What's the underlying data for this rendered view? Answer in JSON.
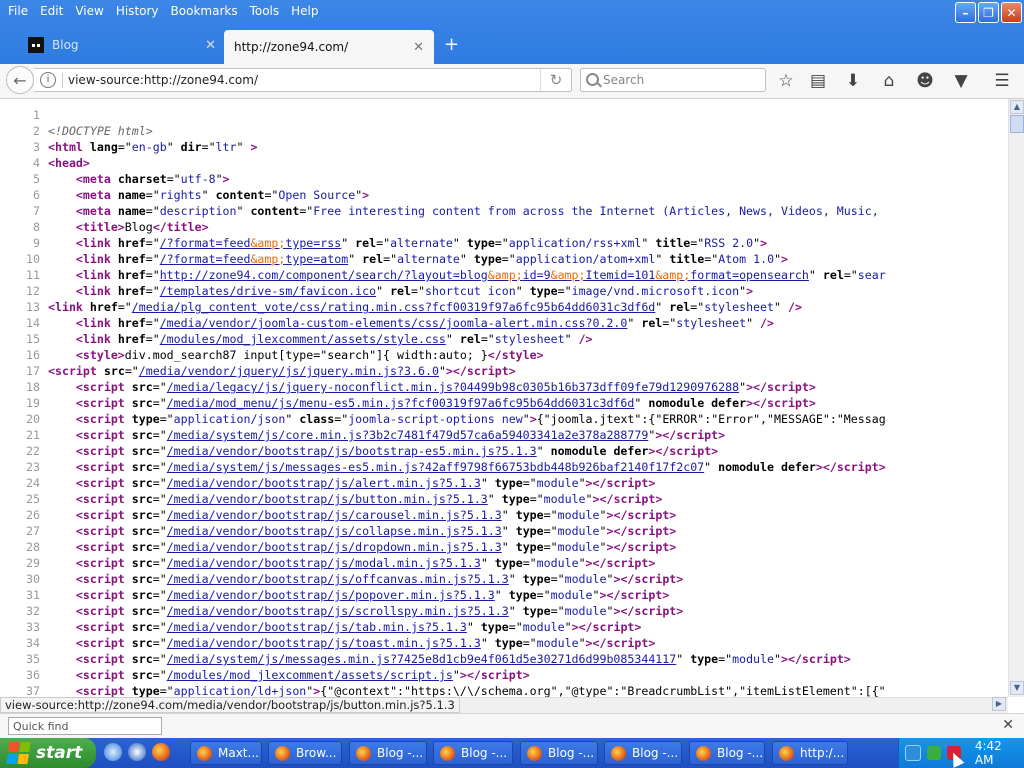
{
  "menu": [
    "File",
    "Edit",
    "View",
    "History",
    "Bookmarks",
    "Tools",
    "Help"
  ],
  "tabs": [
    {
      "title": "Blog",
      "active": false
    },
    {
      "title": "http://zone94.com/",
      "active": true
    }
  ],
  "url": "view-source:http://zone94.com/",
  "search_placeholder": "Search",
  "status_text": "view-source:http://zone94.com/media/vendor/bootstrap/js/button.min.js?5.1.3",
  "find_placeholder": "Quick find",
  "source_lines": [
    {
      "n": "1",
      "h": ""
    },
    {
      "n": "2",
      "h": "<span class=\"cmt\">&lt;!DOCTYPE html&gt;</span>"
    },
    {
      "n": "3",
      "h": "<span class=\"kw\">&lt;html</span> <span class=\"at\">lang</span>=\"<span class=\"val\">en-gb</span>\" <span class=\"at\">dir</span>=\"<span class=\"val\">ltr</span>\" <span class=\"kw\">&gt;</span>"
    },
    {
      "n": "4",
      "h": "<span class=\"kw\">&lt;head&gt;</span>"
    },
    {
      "n": "5",
      "h": "    <span class=\"kw\">&lt;meta</span> <span class=\"at\">charset</span>=\"<span class=\"val\">utf-8</span>\"<span class=\"kw\">&gt;</span>"
    },
    {
      "n": "6",
      "h": "    <span class=\"kw\">&lt;meta</span> <span class=\"at\">name</span>=\"<span class=\"val\">rights</span>\" <span class=\"at\">content</span>=\"<span class=\"val\">Open Source</span>\"<span class=\"kw\">&gt;</span>"
    },
    {
      "n": "7",
      "h": "    <span class=\"kw\">&lt;meta</span> <span class=\"at\">name</span>=\"<span class=\"val\">description</span>\" <span class=\"at\">content</span>=\"<span class=\"val\">Free interesting content from across the Internet (Articles, News, Videos, Music,</span>"
    },
    {
      "n": "8",
      "h": "    <span class=\"kw\">&lt;title&gt;</span>Blog<span class=\"kw\">&lt;/title&gt;</span>"
    },
    {
      "n": "9",
      "h": "    <span class=\"kw\">&lt;link</span> <span class=\"at\">href</span>=\"<span class=\"lnk\">/?format=feed<span class=\"ent\">&amp;amp;</span>type=rss</span>\" <span class=\"at\">rel</span>=\"<span class=\"val\">alternate</span>\" <span class=\"at\">type</span>=\"<span class=\"val\">application/rss+xml</span>\" <span class=\"at\">title</span>=\"<span class=\"val\">RSS 2.0</span>\"<span class=\"kw\">&gt;</span>"
    },
    {
      "n": "10",
      "h": "    <span class=\"kw\">&lt;link</span> <span class=\"at\">href</span>=\"<span class=\"lnk\">/?format=feed<span class=\"ent\">&amp;amp;</span>type=atom</span>\" <span class=\"at\">rel</span>=\"<span class=\"val\">alternate</span>\" <span class=\"at\">type</span>=\"<span class=\"val\">application/atom+xml</span>\" <span class=\"at\">title</span>=\"<span class=\"val\">Atom 1.0</span>\"<span class=\"kw\">&gt;</span>"
    },
    {
      "n": "11",
      "h": "    <span class=\"kw\">&lt;link</span> <span class=\"at\">href</span>=\"<span class=\"lnk\">http://zone94.com/component/search/?layout=blog<span class=\"ent\">&amp;amp;</span>id=9<span class=\"ent\">&amp;amp;</span>Itemid=101<span class=\"ent\">&amp;amp;</span>format=opensearch</span>\" <span class=\"at\">rel</span>=\"<span class=\"val\">sear</span>"
    },
    {
      "n": "12",
      "h": "    <span class=\"kw\">&lt;link</span> <span class=\"at\">href</span>=\"<span class=\"lnk\">/templates/drive-sm/favicon.ico</span>\" <span class=\"at\">rel</span>=\"<span class=\"val\">shortcut icon</span>\" <span class=\"at\">type</span>=\"<span class=\"val\">image/vnd.microsoft.icon</span>\"<span class=\"kw\">&gt;</span>"
    },
    {
      "n": "13",
      "h": "<span class=\"kw\">&lt;link</span> <span class=\"at\">href</span>=\"<span class=\"lnk\">/media/plg_content_vote/css/rating.min.css?fcf00319f97a6fc95b64dd6031c3df6d</span>\" <span class=\"at\">rel</span>=\"<span class=\"val\">stylesheet</span>\" <span class=\"kw\">/&gt;</span>"
    },
    {
      "n": "14",
      "h": "    <span class=\"kw\">&lt;link</span> <span class=\"at\">href</span>=\"<span class=\"lnk\">/media/vendor/joomla-custom-elements/css/joomla-alert.min.css?0.2.0</span>\" <span class=\"at\">rel</span>=\"<span class=\"val\">stylesheet</span>\" <span class=\"kw\">/&gt;</span>"
    },
    {
      "n": "15",
      "h": "    <span class=\"kw\">&lt;link</span> <span class=\"at\">href</span>=\"<span class=\"lnk\">/modules/mod_jlexcomment/assets/style.css</span>\" <span class=\"at\">rel</span>=\"<span class=\"val\">stylesheet</span>\" <span class=\"kw\">/&gt;</span>"
    },
    {
      "n": "16",
      "h": "    <span class=\"kw\">&lt;style&gt;</span>div.mod_search87 input[type=\"search\"]{ width:auto; }<span class=\"kw\">&lt;/style&gt;</span>"
    },
    {
      "n": "17",
      "h": "<span class=\"kw\">&lt;script</span> <span class=\"at\">src</span>=\"<span class=\"lnk\">/media/vendor/jquery/js/jquery.min.js?3.6.0</span>\"<span class=\"kw\">&gt;&lt;/script&gt;</span>"
    },
    {
      "n": "18",
      "h": "    <span class=\"kw\">&lt;script</span> <span class=\"at\">src</span>=\"<span class=\"lnk\">/media/legacy/js/jquery-noconflict.min.js?04499b98c0305b16b373dff09fe79d1290976288</span>\"<span class=\"kw\">&gt;&lt;/script&gt;</span>"
    },
    {
      "n": "19",
      "h": "    <span class=\"kw\">&lt;script</span> <span class=\"at\">src</span>=\"<span class=\"lnk\">/media/mod_menu/js/menu-es5.min.js?fcf00319f97a6fc95b64dd6031c3df6d</span>\" <span class=\"at\">nomodule defer</span><span class=\"kw\">&gt;&lt;/script&gt;</span>"
    },
    {
      "n": "20",
      "h": "    <span class=\"kw\">&lt;script</span> <span class=\"at\">type</span>=\"<span class=\"val\">application/json</span>\" <span class=\"at\">class</span>=\"<span class=\"val\">joomla-script-options new</span>\"<span class=\"kw\">&gt;</span>{\"joomla.jtext\":{\"ERROR\":\"Error\",\"MESSAGE\":\"Messag"
    },
    {
      "n": "21",
      "h": "    <span class=\"kw\">&lt;script</span> <span class=\"at\">src</span>=\"<span class=\"lnk\">/media/system/js/core.min.js?3b2c7481f479d57ca6a59403341a2e378a288779</span>\"<span class=\"kw\">&gt;&lt;/script&gt;</span>"
    },
    {
      "n": "22",
      "h": "    <span class=\"kw\">&lt;script</span> <span class=\"at\">src</span>=\"<span class=\"lnk\">/media/vendor/bootstrap/js/bootstrap-es5.min.js?5.1.3</span>\" <span class=\"at\">nomodule defer</span><span class=\"kw\">&gt;&lt;/script&gt;</span>"
    },
    {
      "n": "23",
      "h": "    <span class=\"kw\">&lt;script</span> <span class=\"at\">src</span>=\"<span class=\"lnk\">/media/system/js/messages-es5.min.js?42aff9798f66753bdb448b926baf2140f17f2c07</span>\" <span class=\"at\">nomodule defer</span><span class=\"kw\">&gt;&lt;/script&gt;</span>"
    },
    {
      "n": "24",
      "h": "    <span class=\"kw\">&lt;script</span> <span class=\"at\">src</span>=\"<span class=\"lnk\">/media/vendor/bootstrap/js/alert.min.js?5.1.3</span>\" <span class=\"at\">type</span>=\"<span class=\"val\">module</span>\"<span class=\"kw\">&gt;&lt;/script&gt;</span>"
    },
    {
      "n": "25",
      "h": "    <span class=\"kw\">&lt;script</span> <span class=\"at\">src</span>=\"<span class=\"lnk\">/media/vendor/bootstrap/js/button.min.js?5.1.3</span>\" <span class=\"at\">type</span>=\"<span class=\"val\">module</span>\"<span class=\"kw\">&gt;&lt;/script&gt;</span>"
    },
    {
      "n": "26",
      "h": "    <span class=\"kw\">&lt;script</span> <span class=\"at\">src</span>=\"<span class=\"lnk\">/media/vendor/bootstrap/js/carousel.min.js?5.1.3</span>\" <span class=\"at\">type</span>=\"<span class=\"val\">module</span>\"<span class=\"kw\">&gt;&lt;/script&gt;</span>"
    },
    {
      "n": "27",
      "h": "    <span class=\"kw\">&lt;script</span> <span class=\"at\">src</span>=\"<span class=\"lnk\">/media/vendor/bootstrap/js/collapse.min.js?5.1.3</span>\" <span class=\"at\">type</span>=\"<span class=\"val\">module</span>\"<span class=\"kw\">&gt;&lt;/script&gt;</span>"
    },
    {
      "n": "28",
      "h": "    <span class=\"kw\">&lt;script</span> <span class=\"at\">src</span>=\"<span class=\"lnk\">/media/vendor/bootstrap/js/dropdown.min.js?5.1.3</span>\" <span class=\"at\">type</span>=\"<span class=\"val\">module</span>\"<span class=\"kw\">&gt;&lt;/script&gt;</span>"
    },
    {
      "n": "29",
      "h": "    <span class=\"kw\">&lt;script</span> <span class=\"at\">src</span>=\"<span class=\"lnk\">/media/vendor/bootstrap/js/modal.min.js?5.1.3</span>\" <span class=\"at\">type</span>=\"<span class=\"val\">module</span>\"<span class=\"kw\">&gt;&lt;/script&gt;</span>"
    },
    {
      "n": "30",
      "h": "    <span class=\"kw\">&lt;script</span> <span class=\"at\">src</span>=\"<span class=\"lnk\">/media/vendor/bootstrap/js/offcanvas.min.js?5.1.3</span>\" <span class=\"at\">type</span>=\"<span class=\"val\">module</span>\"<span class=\"kw\">&gt;&lt;/script&gt;</span>"
    },
    {
      "n": "31",
      "h": "    <span class=\"kw\">&lt;script</span> <span class=\"at\">src</span>=\"<span class=\"lnk\">/media/vendor/bootstrap/js/popover.min.js?5.1.3</span>\" <span class=\"at\">type</span>=\"<span class=\"val\">module</span>\"<span class=\"kw\">&gt;&lt;/script&gt;</span>"
    },
    {
      "n": "32",
      "h": "    <span class=\"kw\">&lt;script</span> <span class=\"at\">src</span>=\"<span class=\"lnk\">/media/vendor/bootstrap/js/scrollspy.min.js?5.1.3</span>\" <span class=\"at\">type</span>=\"<span class=\"val\">module</span>\"<span class=\"kw\">&gt;&lt;/script&gt;</span>"
    },
    {
      "n": "33",
      "h": "    <span class=\"kw\">&lt;script</span> <span class=\"at\">src</span>=\"<span class=\"lnk\">/media/vendor/bootstrap/js/tab.min.js?5.1.3</span>\" <span class=\"at\">type</span>=\"<span class=\"val\">module</span>\"<span class=\"kw\">&gt;&lt;/script&gt;</span>"
    },
    {
      "n": "34",
      "h": "    <span class=\"kw\">&lt;script</span> <span class=\"at\">src</span>=\"<span class=\"lnk\">/media/vendor/bootstrap/js/toast.min.js?5.1.3</span>\" <span class=\"at\">type</span>=\"<span class=\"val\">module</span>\"<span class=\"kw\">&gt;&lt;/script&gt;</span>"
    },
    {
      "n": "35",
      "h": "    <span class=\"kw\">&lt;script</span> <span class=\"at\">src</span>=\"<span class=\"lnk\">/media/system/js/messages.min.js?7425e8d1cb9e4f061d5e30271d6d99b085344117</span>\" <span class=\"at\">type</span>=\"<span class=\"val\">module</span>\"<span class=\"kw\">&gt;&lt;/script&gt;</span>"
    },
    {
      "n": "36",
      "h": "    <span class=\"kw\">&lt;script</span> <span class=\"at\">src</span>=\"<span class=\"lnk\">/modules/mod_jlexcomment/assets/script.js</span>\"<span class=\"kw\">&gt;&lt;/script&gt;</span>"
    },
    {
      "n": "37",
      "h": "    <span class=\"kw\">&lt;script</span> <span class=\"at\">type</span>=\"<span class=\"val\">application/ld+json</span>\"<span class=\"kw\">&gt;</span>{\"@context\":\"https:\\/\\/schema.org\",\"@type\":\"BreadcrumbList\",\"itemListElement\":[{\""
    }
  ],
  "taskbar": {
    "start_label": "start",
    "tasks": [
      "Maxt...",
      "Brow...",
      "Blog -...",
      "Blog -...",
      "Blog -...",
      "Blog -...",
      "Blog -...",
      "http:/..."
    ],
    "clock": "4:42 AM"
  }
}
